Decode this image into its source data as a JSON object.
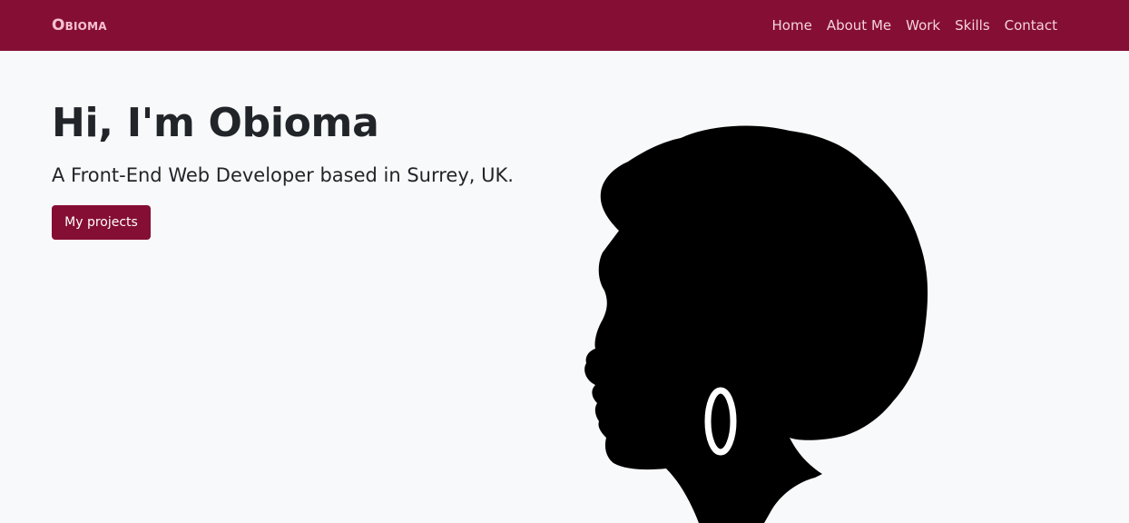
{
  "navbar": {
    "brand": "Obioma",
    "links": [
      "Home",
      "About Me",
      "Work",
      "Skills",
      "Contact"
    ]
  },
  "hero": {
    "title": "Hi, I'm Obioma",
    "lead": "A Front-End Web Developer based in Surrey, UK.",
    "button_label": "My projects"
  },
  "colors": {
    "brand": "#850e35",
    "background": "#f8f9fa",
    "text": "#212529"
  },
  "illustration": {
    "icon": "woman-silhouette-icon"
  }
}
